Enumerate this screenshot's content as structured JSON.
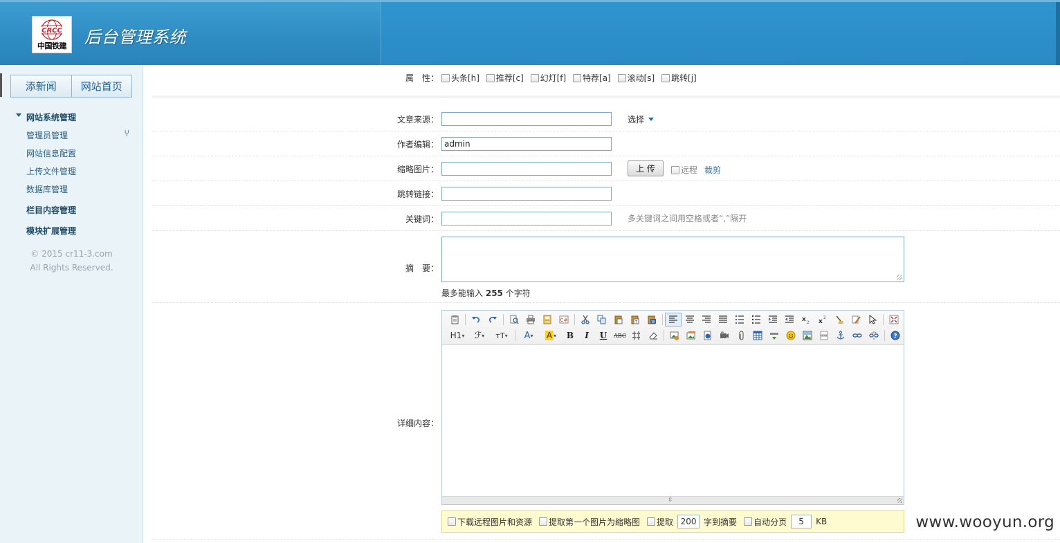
{
  "header": {
    "title": "后台管理系统",
    "logo_text": "中国铁建",
    "logo_mark": "CRCC"
  },
  "sidebar": {
    "buttons": [
      "添新闻",
      "网站首页"
    ],
    "groups": [
      {
        "label": "网站系统管理",
        "items": [
          "管理员管理",
          "网站信息配置",
          "上传文件管理",
          "数据库管理"
        ]
      },
      {
        "label": "栏目内容管理"
      },
      {
        "label": "模块扩展管理"
      }
    ],
    "copyright_line1": "© 2015 cr11-3.com",
    "copyright_line2": "All Rights Reserved."
  },
  "form": {
    "attr_label": "属　性：",
    "attr_options": [
      "头条[h]",
      "推荐[c]",
      "幻灯[f]",
      "特荐[a]",
      "滚动[s]",
      "跳转[j]"
    ],
    "source_label": "文章来源：",
    "source_value": "",
    "select_label": "选择",
    "author_label": "作者编辑：",
    "author_value": "admin",
    "thumb_label": "缩略图片：",
    "thumb_value": "",
    "upload_label": "上 传",
    "remote_label": "远程",
    "crop_label": "裁剪",
    "redirect_label": "跳转链接：",
    "redirect_value": "",
    "keywords_label": "关键词：",
    "keywords_value": "",
    "keywords_hint": "多关键词之间用空格或者“,”隔开",
    "summary_label": "摘　要：",
    "maxlen_prefix": "最多能输入",
    "maxlen_value": "255",
    "maxlen_suffix": "个字符",
    "content_label": "详细内容："
  },
  "editor": {
    "row1": [
      "source",
      "undo",
      "redo",
      "preview",
      "print",
      "template",
      "code",
      "cut",
      "copy",
      "paste",
      "paste-plain",
      "paste-word",
      "align-left",
      "align-center",
      "align-right",
      "justify",
      "ordered-list",
      "unordered-list",
      "indent",
      "outdent",
      "subscript",
      "superscript",
      "clear-format",
      "select-all",
      "fullscreen"
    ],
    "row2_text": [
      "H1",
      "ℱ",
      "тT",
      "A",
      "A",
      "B",
      "I",
      "U",
      "ABC"
    ]
  },
  "options": {
    "download_remote": "下载远程图片和资源",
    "first_image_thumb": "提取第一个图片为缩略图",
    "extract_prefix": "提取",
    "extract_chars": "200",
    "extract_suffix": "字到摘要",
    "auto_page": "自动分页",
    "page_size": "5",
    "page_unit": "KB"
  },
  "watermark": "www.wooyun.org"
}
